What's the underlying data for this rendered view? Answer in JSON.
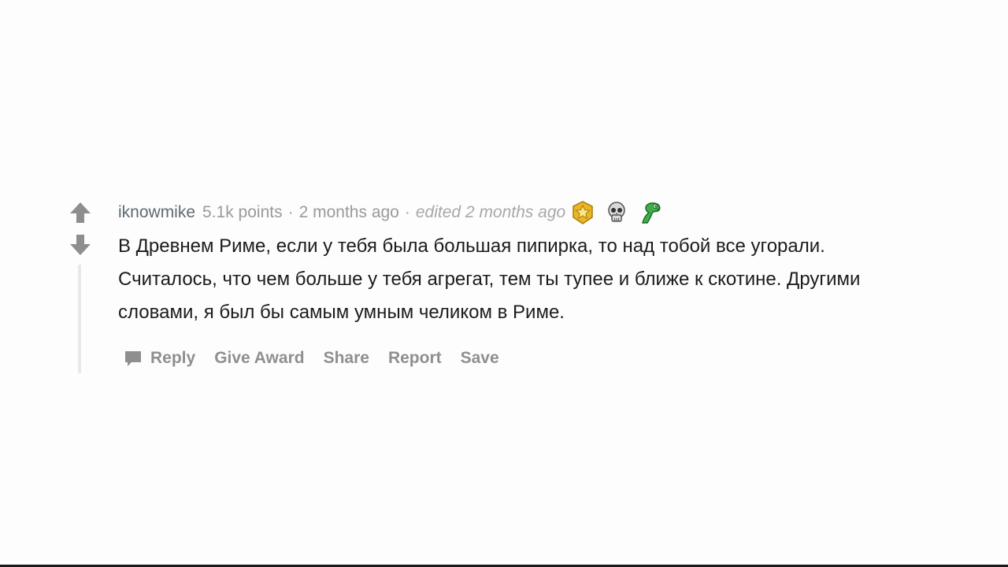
{
  "comment": {
    "author": "iknowmike",
    "points": "5.1k points",
    "separator": "·",
    "time": "2 months ago",
    "edited": "edited 2 months ago",
    "body": "В Древнем Риме, если у тебя была большая пипирка, то над тобой все угорали. Считалось, что чем больше у тебя агрегат, тем ты тупее и ближе к скотине. Другими словами, я был бы самым умным челиком в Риме.",
    "awards": [
      {
        "icon": "gold-star-award-icon",
        "color": "#e8b722"
      },
      {
        "icon": "skull-award-icon",
        "color": "#d9d9d9"
      },
      {
        "icon": "green-creature-award-icon",
        "color": "#3fae4a"
      }
    ],
    "actions": {
      "reply": "Reply",
      "give_award": "Give Award",
      "share": "Share",
      "report": "Report",
      "save": "Save"
    }
  },
  "colors": {
    "arrow": "#8e8e8e",
    "meta_text": "#9a9a9a",
    "body_text": "#1c1c1c",
    "action_text": "#8f8f8f",
    "thread_line": "#e9e9e9",
    "background": "#fdfdfd"
  }
}
